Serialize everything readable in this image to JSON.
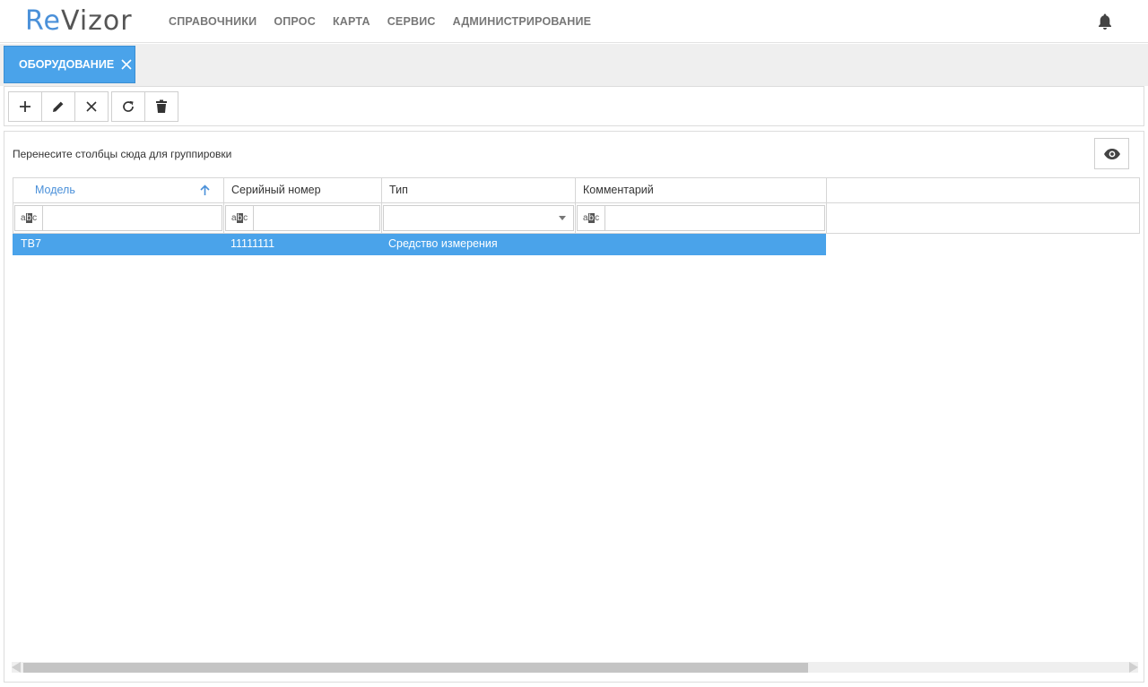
{
  "logo": {
    "part1": "Re",
    "part2": "Vizor"
  },
  "nav": [
    {
      "label": "СПРАВОЧНИКИ"
    },
    {
      "label": "ОПРОС"
    },
    {
      "label": "КАРТА"
    },
    {
      "label": "СЕРВИС"
    },
    {
      "label": "АДМИНИСТРИРОВАНИЕ"
    }
  ],
  "header_icons": {
    "notifications": "bell-icon"
  },
  "tabs": [
    {
      "label": "ОБОРУДОВАНИЕ",
      "active": true
    }
  ],
  "toolbar": {
    "buttons": [
      {
        "icon": "plus-icon",
        "action": "add"
      },
      {
        "icon": "pencil-icon",
        "action": "edit"
      },
      {
        "icon": "close-icon",
        "action": "cancel"
      },
      {
        "icon": "refresh-icon",
        "action": "refresh"
      },
      {
        "icon": "trash-icon",
        "action": "delete"
      }
    ]
  },
  "grid": {
    "group_hint": "Перенесите столбцы сюда для группировки",
    "column_chooser_icon": "eye-icon",
    "columns": [
      {
        "label": "Модель",
        "sorted": "asc"
      },
      {
        "label": "Серийный номер"
      },
      {
        "label": "Тип"
      },
      {
        "label": "Комментарий"
      }
    ],
    "filters": [
      {
        "kind": "text",
        "badge": "abc",
        "value": ""
      },
      {
        "kind": "text",
        "badge": "abc",
        "value": ""
      },
      {
        "kind": "select",
        "value": ""
      },
      {
        "kind": "text",
        "badge": "abc",
        "value": ""
      }
    ],
    "rows": [
      {
        "model": "ТВ7",
        "serial": "11111111",
        "type": "Средство измерения",
        "comment": "",
        "selected": true
      }
    ]
  },
  "colors": {
    "accent": "#4aa3ea",
    "brand": "#4a90d9",
    "nav_text": "#777777",
    "selected_row": "#4aa3ea"
  }
}
